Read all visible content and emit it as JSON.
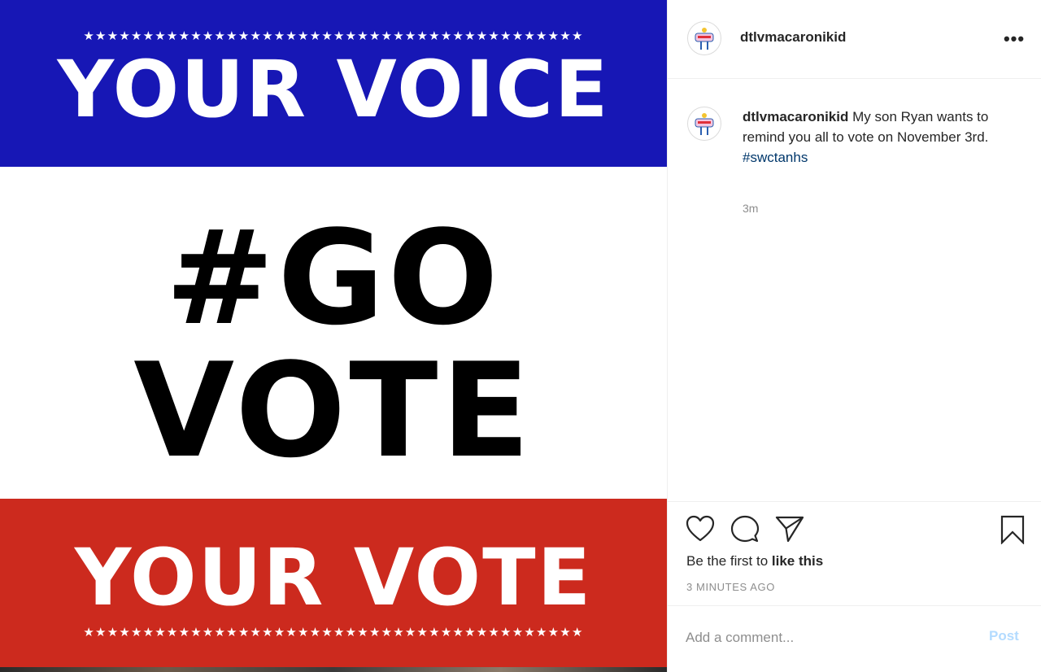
{
  "image": {
    "stars": "★★★★★★★★★★★★★★★★★★★★★★★★★★★★★★★★★★★★★★★★★★",
    "top_banner": "YOUR VOICE",
    "main_line_1": "#GO",
    "main_line_2": "VOTE",
    "bottom_banner": "YOUR VOTE",
    "colors": {
      "blue": "#1717b5",
      "red": "#cc2a1e"
    }
  },
  "header": {
    "username": "dtlvmacaronikid",
    "more_label": "•••"
  },
  "caption": {
    "username": "dtlvmacaronikid",
    "text": "My son Ryan wants to remind you all to vote on November 3rd.",
    "hashtag": "#swctanhs",
    "timestamp": "3m"
  },
  "actions": {
    "likes_prefix": "Be the first to ",
    "likes_link": "like this",
    "time_ago": "3 MINUTES AGO"
  },
  "comment": {
    "placeholder": "Add a comment...",
    "post_label": "Post"
  },
  "icons": [
    "heart-icon",
    "comment-bubble-icon",
    "share-paper-plane-icon",
    "bookmark-icon",
    "more-options-icon"
  ]
}
